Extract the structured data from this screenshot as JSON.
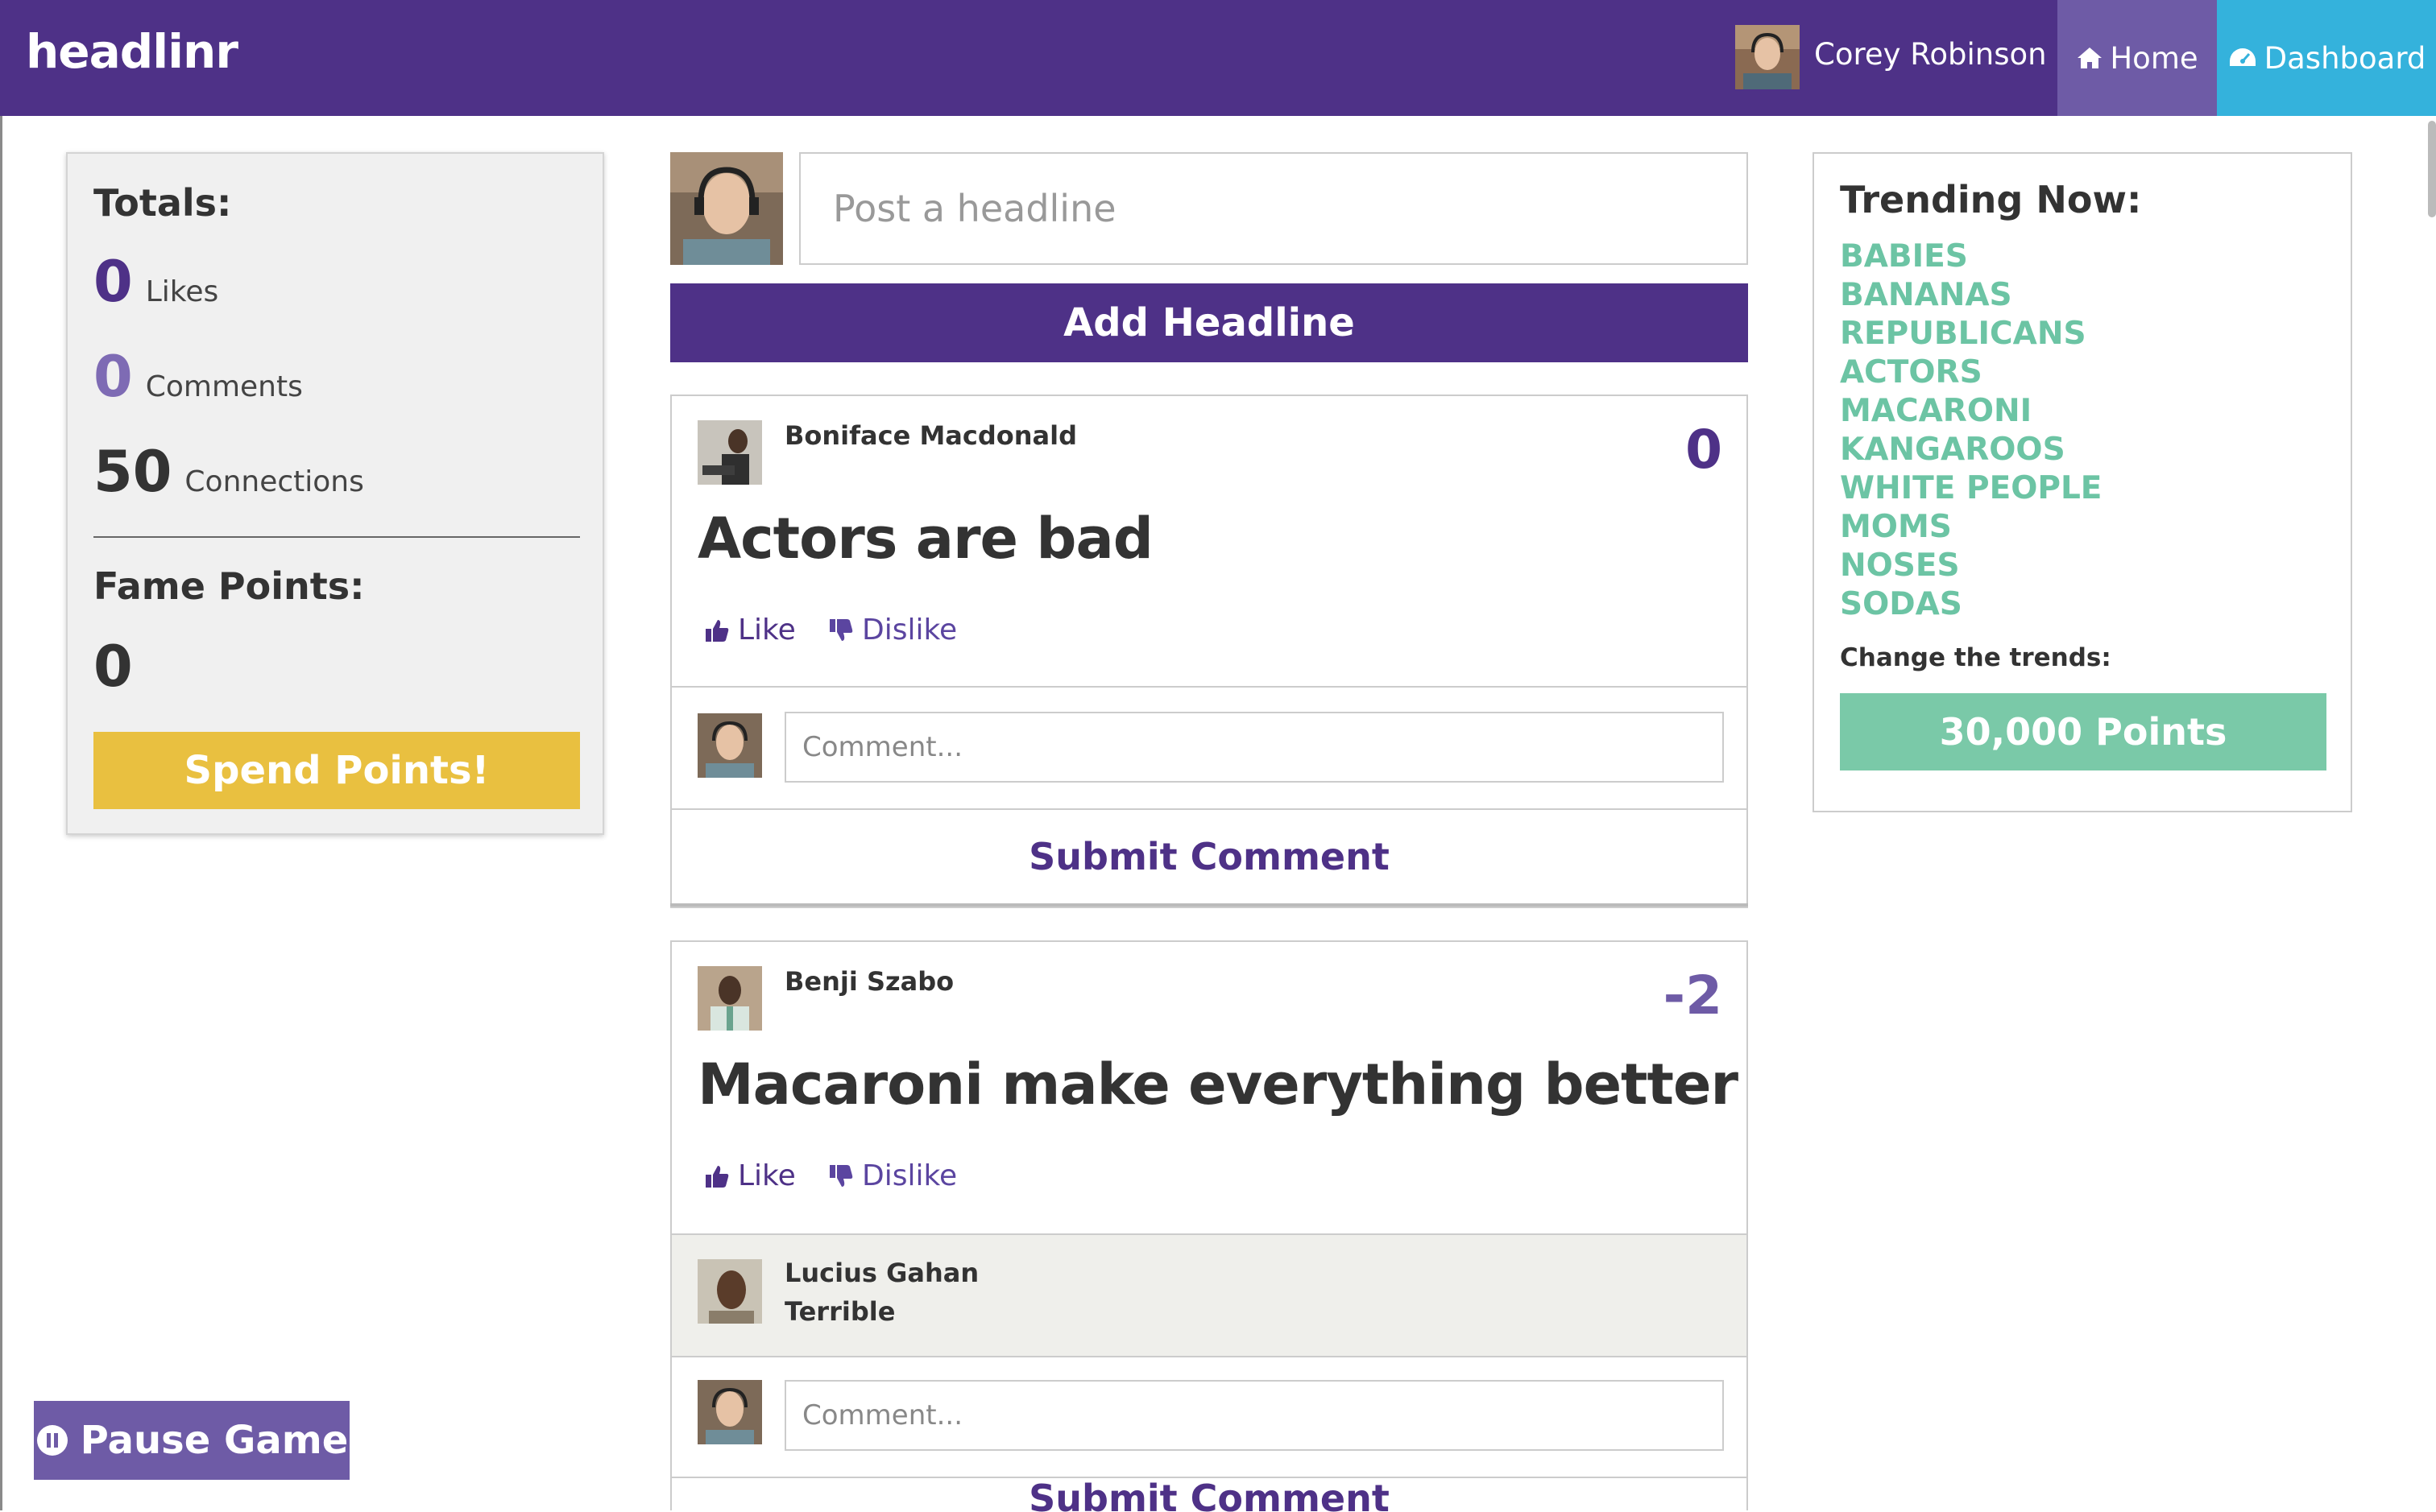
{
  "colors": {
    "brand_purple": "#4e3187",
    "home_tab": "#6e5ba6",
    "dashboard_tab": "#34b2dc",
    "spend_yellow": "#e9c040",
    "trend_green": "#6cc4a4",
    "points_green": "#7ac9a8",
    "comment_bg": "#efefeb",
    "stat_likes": "#4e3187",
    "stat_comments": "#7e6bb4",
    "stat_connections": "#333333",
    "score_positive": "#4e3187",
    "score_negative": "#6e5ba6"
  },
  "navbar": {
    "brand": "headlinr",
    "user_name": "Corey Robinson",
    "home_label": "Home",
    "home_icon": "home-icon",
    "dashboard_label": "Dashboard",
    "dashboard_icon": "dashboard-icon"
  },
  "totals": {
    "heading": "Totals:",
    "likes_value": "0",
    "likes_label": "Likes",
    "comments_value": "0",
    "comments_label": "Comments",
    "connections_value": "50",
    "connections_label": "Connections",
    "fame_heading": "Fame Points:",
    "fame_value": "0",
    "spend_label": "Spend Points!"
  },
  "composer": {
    "placeholder": "Post a headline",
    "button_label": "Add Headline"
  },
  "posts": [
    {
      "author": "Boniface Macdonald",
      "score": "0",
      "headline": "Actors are bad",
      "like_label": "Like",
      "dislike_label": "Dislike",
      "comment_placeholder": "Comment...",
      "submit_label": "Submit Comment",
      "comments": []
    },
    {
      "author": "Benji Szabo",
      "score": "-2",
      "headline": "Macaroni make everything better",
      "like_label": "Like",
      "dislike_label": "Dislike",
      "comment_placeholder": "Comment...",
      "submit_label": "Submit Comment",
      "comments": [
        {
          "author": "Lucius Gahan",
          "text": "Terrible"
        }
      ]
    }
  ],
  "trending": {
    "heading": "Trending Now:",
    "items": [
      "BABIES",
      "BANANAS",
      "REPUBLICANS",
      "ACTORS",
      "MACARONI",
      "KANGAROOS",
      "WHITE PEOPLE",
      "MOMS",
      "NOSES",
      "SODAS"
    ],
    "change_label": "Change the trends:",
    "points_button": "30,000 Points"
  },
  "pause": {
    "label": "Pause Game",
    "icon": "pause-icon"
  }
}
